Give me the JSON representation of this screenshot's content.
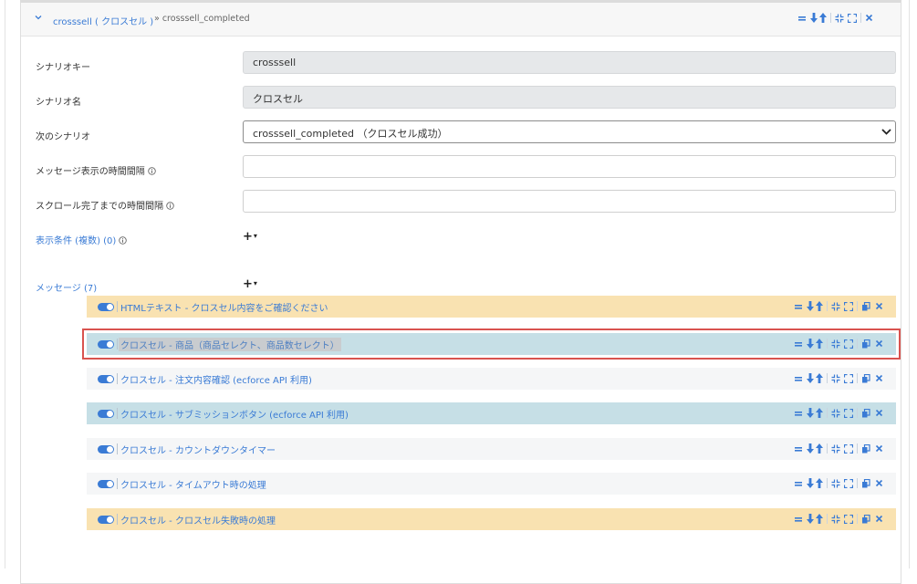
{
  "scenario_panel": {
    "title": "crosssell ( クロスセル )",
    "next_ref": "» crosssell_completed"
  },
  "form": {
    "scenario_key": {
      "label": "シナリオキー",
      "value": "crosssell"
    },
    "scenario_name": {
      "label": "シナリオ名",
      "value": "クロスセル"
    },
    "next_scenario": {
      "label": "次のシナリオ",
      "value": "crosssell_completed （クロスセル成功）"
    },
    "message_interval": {
      "label": "メッセージ表示の時間間隔",
      "value": ""
    },
    "scroll_interval": {
      "label": "スクロール完了までの時間間隔",
      "value": ""
    },
    "display_conditions": {
      "label": "表示条件 (複数) (0)",
      "add_label": "+"
    },
    "messages": {
      "label": "メッセージ (7)",
      "add_label": "+"
    }
  },
  "messages": [
    {
      "label": "HTMLテキスト - クロスセル内容をご確認ください",
      "color": "#f9e2b1",
      "enabled": true
    },
    {
      "label": "クロスセル - 商品（商品セレクト、商品数セレクト）",
      "color": "#c6dfe6",
      "enabled": true,
      "selected": true
    },
    {
      "label": "クロスセル - 注文内容確認 (ecforce API 利用)",
      "color": "#f5f6f7",
      "enabled": true
    },
    {
      "label": "クロスセル - サブミッションボタン (ecforce API 利用)",
      "color": "#c6dfe6",
      "enabled": true
    },
    {
      "label": "クロスセル - カウントダウンタイマー",
      "color": "#f5f6f7",
      "enabled": true
    },
    {
      "label": "クロスセル - タイムアウト時の処理",
      "color": "#f5f6f7",
      "enabled": true
    },
    {
      "label": "クロスセル - クロスセル失敗時の処理",
      "color": "#f9e2b1",
      "enabled": true
    }
  ],
  "icons": {
    "collapse": "chevron-down-icon",
    "reorder": "drag-handle-icon",
    "move_down": "arrow-down-icon",
    "move_up": "arrow-up-icon",
    "collapse_all": "compress-icon",
    "expand_all": "expand-icon",
    "copy": "copy-icon",
    "delete": "close-icon",
    "info": "info-icon",
    "toggle": "toggle-on-icon"
  },
  "colors": {
    "accent": "#3a7bd5",
    "selection_border": "#d9534f"
  }
}
